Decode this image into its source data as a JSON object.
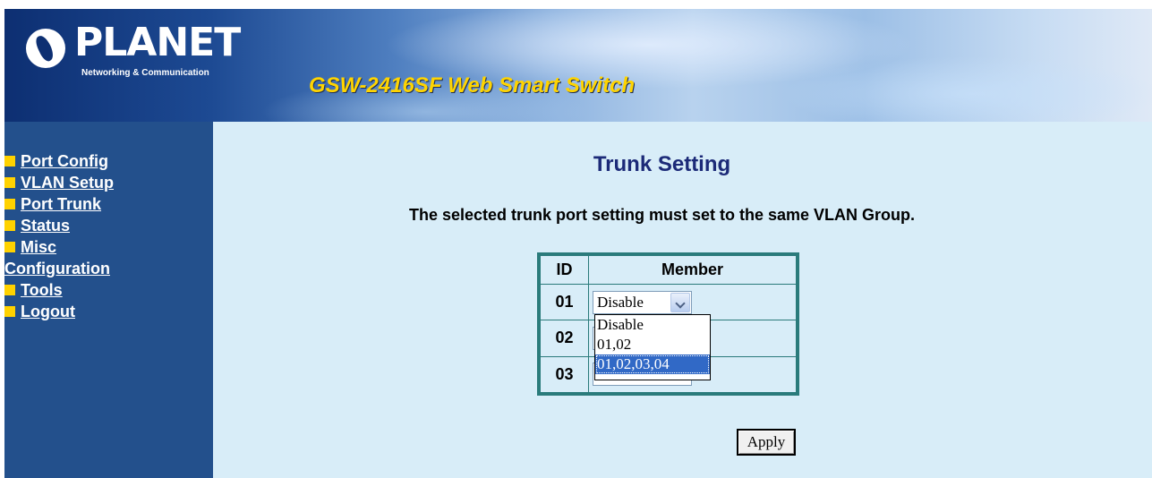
{
  "header": {
    "logo_text": "PLANET",
    "logo_subtitle": "Networking & Communication",
    "product_title": "GSW-2416SF Web Smart Switch"
  },
  "sidebar": {
    "items": [
      {
        "label": "Port Config"
      },
      {
        "label": "VLAN Setup"
      },
      {
        "label": "Port Trunk"
      },
      {
        "label": "Status"
      },
      {
        "label": "Misc"
      },
      {
        "label": "Configuration"
      },
      {
        "label": "Tools"
      },
      {
        "label": "Logout"
      }
    ]
  },
  "main": {
    "title": "Trunk Setting",
    "note": "The selected trunk port setting must set to the same VLAN Group.",
    "table": {
      "headers": {
        "id": "ID",
        "member": "Member"
      },
      "rows": [
        {
          "id": "01",
          "member": "Disable"
        },
        {
          "id": "02",
          "member": ""
        },
        {
          "id": "03",
          "member": ""
        }
      ]
    },
    "dropdown_options": [
      "Disable",
      "01,02",
      "01,02,03,04"
    ],
    "highlighted_option_index": 2,
    "apply_label": "Apply"
  },
  "colors": {
    "sidebar_bg": "#23508c",
    "content_bg": "#d8edf8",
    "bullet": "#ffd200",
    "title": "#1c2a78",
    "product_title": "#ffd400",
    "table_border": "#2a7b7b",
    "option_highlight": "#3169c6"
  }
}
